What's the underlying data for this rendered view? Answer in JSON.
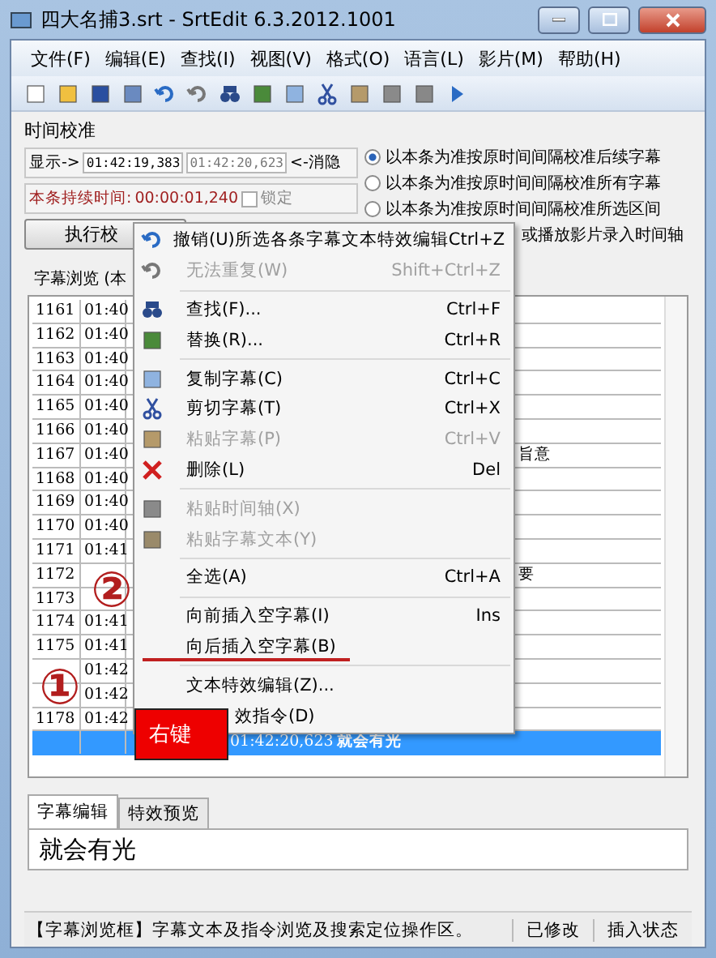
{
  "window": {
    "title": "四大名捕3.srt - SrtEdit 6.3.2012.1001"
  },
  "menu": [
    "文件(F)",
    "编辑(E)",
    "查找(I)",
    "视图(V)",
    "格式(O)",
    "语言(L)",
    "影片(M)",
    "帮助(H)"
  ],
  "calibration": {
    "title": "时间校准",
    "show_label": "显示->",
    "start": "01:42:19,383",
    "end": "01:42:20,623",
    "hide_label": "<-消隐",
    "duration_label": "本条持续时间:",
    "duration": "00:00:01,240",
    "lock_label": "锁定",
    "lock_checked": false,
    "run_button": "执行校",
    "options": [
      {
        "label": "以本条为准按原时间间隔校准后续字幕",
        "selected": true
      },
      {
        "label": "以本条为准按原时间间隔校准所有字幕",
        "selected": false
      },
      {
        "label": "以本条为准按原时间间隔校准所选区间",
        "selected": false
      }
    ],
    "note": "或播放影片录入时间轴"
  },
  "browser": {
    "title": "字幕浏览 (本",
    "rows": [
      {
        "number": "1161",
        "start": "01:40",
        "selected": false
      },
      {
        "number": "1162",
        "start": "01:40",
        "selected": false
      },
      {
        "number": "1163",
        "start": "01:40",
        "selected": false
      },
      {
        "number": "1164",
        "start": "01:40",
        "selected": false
      },
      {
        "number": "1165",
        "start": "01:40",
        "selected": false
      },
      {
        "number": "1166",
        "start": "01:40",
        "selected": false
      },
      {
        "number": "1167",
        "start": "01:40",
        "column_5": "旨意",
        "selected": false
      },
      {
        "number": "1168",
        "start": "01:40",
        "selected": false
      },
      {
        "number": "1169",
        "start": "01:40",
        "selected": false
      },
      {
        "number": "1170",
        "start": "01:40",
        "selected": false
      },
      {
        "number": "1171",
        "start": "01:41",
        "selected": false
      },
      {
        "number": "1172",
        "column_5": "要",
        "selected": false
      },
      {
        "number": "1173",
        "selected": false
      },
      {
        "number": "1174",
        "start": "01:41",
        "selected": false
      },
      {
        "number": "1175",
        "start": "01:41",
        "selected": false
      },
      {
        "start": "01:42",
        "selected": false
      },
      {
        "start": "01:42",
        "selected": false
      },
      {
        "number": "1178",
        "start": "01:42",
        "selected": false
      },
      {
        "end": "01:42:20,623",
        "text": "就会有光",
        "selected": true
      }
    ]
  },
  "context_menu": [
    {
      "kind": "item",
      "label": "撤销(U)所选各条字幕文本特效编辑",
      "shortcut": "Ctrl+Z",
      "disabled": false
    },
    {
      "kind": "item",
      "label": "无法重复(W)",
      "shortcut": "Shift+Ctrl+Z",
      "disabled": true
    },
    {
      "kind": "separator"
    },
    {
      "kind": "item",
      "label": "查找(F)...",
      "shortcut": "Ctrl+F",
      "disabled": false
    },
    {
      "kind": "item",
      "label": "替换(R)...",
      "shortcut": "Ctrl+R",
      "disabled": false
    },
    {
      "kind": "separator"
    },
    {
      "kind": "item",
      "label": "复制字幕(C)",
      "shortcut": "Ctrl+C",
      "disabled": false
    },
    {
      "kind": "item",
      "label": "剪切字幕(T)",
      "shortcut": "Ctrl+X",
      "disabled": false
    },
    {
      "kind": "item",
      "label": "粘贴字幕(P)",
      "shortcut": "Ctrl+V",
      "disabled": true
    },
    {
      "kind": "item",
      "label": "删除(L)",
      "shortcut": "Del",
      "disabled": false
    },
    {
      "kind": "separator"
    },
    {
      "kind": "item",
      "label": "粘贴时间轴(X)",
      "disabled": true
    },
    {
      "kind": "item",
      "label": "粘贴字幕文本(Y)",
      "disabled": true
    },
    {
      "kind": "separator"
    },
    {
      "kind": "item",
      "label": "全选(A)",
      "shortcut": "Ctrl+A",
      "disabled": false
    },
    {
      "kind": "separator"
    },
    {
      "kind": "item",
      "label": "向前插入空字幕(I)",
      "shortcut": "Ins",
      "disabled": false
    },
    {
      "kind": "item",
      "label": "向后插入空字幕(B)",
      "disabled": false
    },
    {
      "kind": "separator"
    },
    {
      "kind": "item",
      "label": "文本特效编辑(Z)...",
      "disabled": false
    },
    {
      "kind": "partial",
      "label": "效指令(D)",
      "disabled": false
    }
  ],
  "annotations": {
    "circle_1": "①",
    "circle_2": "②",
    "callout": "右键"
  },
  "editor": {
    "tabs": [
      {
        "label": "字幕编辑",
        "selected": true
      },
      {
        "label": "特效预览",
        "selected": false
      }
    ],
    "value": "就会有光"
  },
  "status_bar": {
    "message": "【字幕浏览框】字幕文本及指令浏览及搜索定位操作区。",
    "modified": "已修改",
    "mode": "插入状态"
  }
}
